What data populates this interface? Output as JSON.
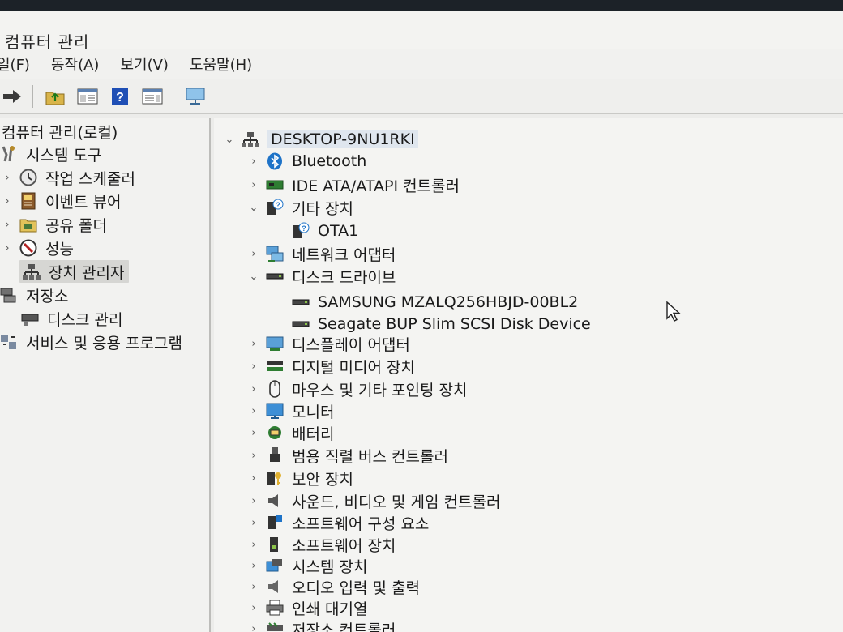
{
  "window": {
    "title": "컴퓨터 관리"
  },
  "menu": [
    "일(F)",
    "동작(A)",
    "보기(V)",
    "도움말(H)"
  ],
  "toolbar": [
    "forward-arrow-icon",
    "folder-up-icon",
    "show-hide-tree-icon",
    "help-icon",
    "properties-icon",
    "monitor-icon"
  ],
  "left_tree": {
    "root": "컴퓨터 관리(로컬)",
    "system_tools": "시스템 도구",
    "task_scheduler": "작업 스케줄러",
    "event_viewer": "이벤트 뷰어",
    "shared_folders": "공유 폴더",
    "performance": "성능",
    "device_manager": "장치 관리자",
    "storage": "저장소",
    "disk_management": "디스크 관리",
    "services": "서비스 및 응용 프로그램"
  },
  "device_tree": {
    "host": "DESKTOP-9NU1RKI",
    "categories": [
      {
        "label": "Bluetooth",
        "expanded": false
      },
      {
        "label": "IDE ATA/ATAPI 컨트롤러",
        "expanded": false
      },
      {
        "label": "기타 장치",
        "expanded": true,
        "children": [
          "OTA1"
        ]
      },
      {
        "label": "네트워크 어댑터",
        "expanded": false
      },
      {
        "label": "디스크 드라이브",
        "expanded": true,
        "children": [
          "SAMSUNG MZALQ256HBJD-00BL2",
          "Seagate BUP Slim SCSI Disk Device"
        ]
      },
      {
        "label": "디스플레이 어댑터",
        "expanded": false
      },
      {
        "label": "디지털 미디어 장치",
        "expanded": false
      },
      {
        "label": "마우스 및 기타 포인팅 장치",
        "expanded": false
      },
      {
        "label": "모니터",
        "expanded": false
      },
      {
        "label": "배터리",
        "expanded": false
      },
      {
        "label": "범용 직렬 버스 컨트롤러",
        "expanded": false
      },
      {
        "label": "보안 장치",
        "expanded": false
      },
      {
        "label": "사운드, 비디오 및 게임 컨트롤러",
        "expanded": false
      },
      {
        "label": "소프트웨어 구성 요소",
        "expanded": false
      },
      {
        "label": "소프트웨어 장치",
        "expanded": false
      },
      {
        "label": "시스템 장치",
        "expanded": false
      },
      {
        "label": "오디오 입력 및 출력",
        "expanded": false
      },
      {
        "label": "인쇄 대기열",
        "expanded": false
      },
      {
        "label": "저장소 컨트롤러",
        "expanded": false
      }
    ]
  },
  "colors": {
    "selection": "#d6d6d3",
    "accent": "#1e73c8",
    "pane_border": "#bdbdba"
  }
}
